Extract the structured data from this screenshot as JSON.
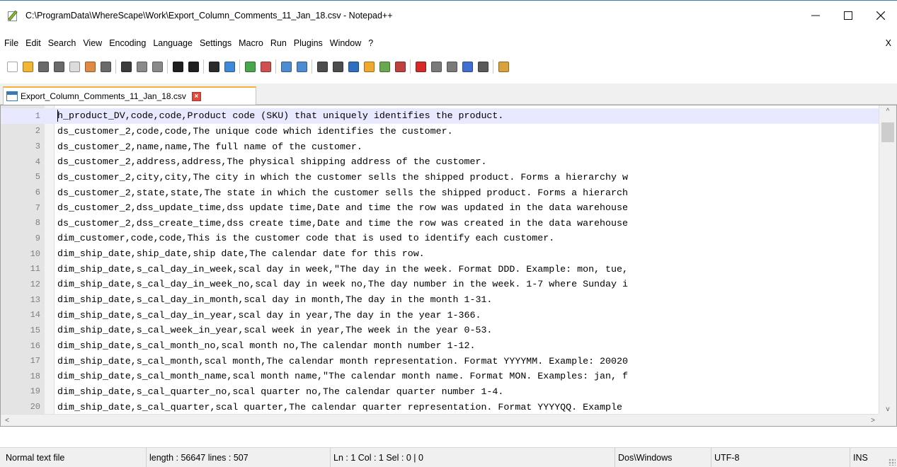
{
  "window": {
    "title": "C:\\ProgramData\\WhereScape\\Work\\Export_Column_Comments_11_Jan_18.csv - Notepad++",
    "minimize_glyph": "—",
    "maximize_glyph": "☐",
    "close_glyph": "✕"
  },
  "menu": {
    "items": [
      "File",
      "Edit",
      "Search",
      "View",
      "Encoding",
      "Language",
      "Settings",
      "Macro",
      "Run",
      "Plugins",
      "Window",
      "?"
    ],
    "close_label": "X"
  },
  "toolbar": {
    "icons": [
      {
        "name": "new-file-icon",
        "color": "#ffffff"
      },
      {
        "name": "open-file-icon",
        "color": "#f2b636"
      },
      {
        "name": "save-icon",
        "color": "#6a6a6a"
      },
      {
        "name": "save-all-icon",
        "color": "#6a6a6a"
      },
      {
        "name": "close-file-icon",
        "color": "#dcdcdc"
      },
      {
        "name": "close-all-icon",
        "color": "#e08b45"
      },
      {
        "name": "print-icon",
        "color": "#6a6a6a"
      },
      {
        "sep": true
      },
      {
        "name": "cut-icon",
        "color": "#3b3b3b"
      },
      {
        "name": "copy-icon",
        "color": "#8a8a8a"
      },
      {
        "name": "paste-icon",
        "color": "#8a8a8a"
      },
      {
        "sep": true
      },
      {
        "name": "undo-icon",
        "color": "#1f1f1f"
      },
      {
        "name": "redo-icon",
        "color": "#1f1f1f"
      },
      {
        "sep": true
      },
      {
        "name": "find-icon",
        "color": "#2b2b2b"
      },
      {
        "name": "replace-icon",
        "color": "#3e8ad8"
      },
      {
        "sep": true
      },
      {
        "name": "zoom-in-icon",
        "color": "#4aa64a"
      },
      {
        "name": "zoom-out-icon",
        "color": "#d05050"
      },
      {
        "sep": true
      },
      {
        "name": "sync-vertical-icon",
        "color": "#4d8cd1"
      },
      {
        "name": "sync-horizontal-icon",
        "color": "#4d8cd1"
      },
      {
        "sep": true
      },
      {
        "name": "word-wrap-icon",
        "color": "#4d4d4d"
      },
      {
        "name": "show-all-chars-icon",
        "color": "#4d4d4d"
      },
      {
        "name": "indent-guide-icon",
        "color": "#2f6fbf"
      },
      {
        "name": "doc-map-icon",
        "color": "#f0a830"
      },
      {
        "name": "function-list-icon",
        "color": "#6aa84f"
      },
      {
        "name": "folder-as-workspace-icon",
        "color": "#c04040"
      },
      {
        "sep": true
      },
      {
        "name": "record-macro-icon",
        "color": "#d42a2a"
      },
      {
        "name": "stop-macro-icon",
        "color": "#7a7a7a"
      },
      {
        "name": "play-macro-icon",
        "color": "#7a7a7a"
      },
      {
        "name": "run-macro-multiple-icon",
        "color": "#3f6fd0"
      },
      {
        "name": "save-macro-icon",
        "color": "#5a5a5a"
      },
      {
        "sep": true
      },
      {
        "name": "plugin-icon",
        "color": "#d9a23a"
      }
    ]
  },
  "tab": {
    "label": "Export_Column_Comments_11_Jan_18.csv",
    "close_glyph": "×"
  },
  "editor": {
    "lines": [
      {
        "n": "1",
        "text": "h_product_DV,code,code,Product code (SKU) that uniquely identifies the product."
      },
      {
        "n": "2",
        "text": "ds_customer_2,code,code,The unique code which identifies the customer."
      },
      {
        "n": "3",
        "text": "ds_customer_2,name,name,The full name of the customer."
      },
      {
        "n": "4",
        "text": "ds_customer_2,address,address,The physical shipping address of the customer."
      },
      {
        "n": "5",
        "text": "ds_customer_2,city,city,The city in which the customer sells the shipped product. Forms a hierarchy w"
      },
      {
        "n": "6",
        "text": "ds_customer_2,state,state,The state in which the customer sells the shipped product. Forms a hierarch"
      },
      {
        "n": "7",
        "text": "ds_customer_2,dss_update_time,dss update time,Date and time the row was updated in the data warehouse"
      },
      {
        "n": "8",
        "text": "ds_customer_2,dss_create_time,dss create time,Date and time the row was created in the data warehouse"
      },
      {
        "n": "9",
        "text": "dim_customer,code,code,This is the customer code that is used to identify each customer."
      },
      {
        "n": "10",
        "text": "dim_ship_date,ship_date,ship date,The calendar date for this row."
      },
      {
        "n": "11",
        "text": "dim_ship_date,s_cal_day_in_week,scal day in week,\"The day in the week. Format DDD. Example: mon, tue,"
      },
      {
        "n": "12",
        "text": "dim_ship_date,s_cal_day_in_week_no,scal day in week no,The day number in the week. 1-7 where Sunday i"
      },
      {
        "n": "13",
        "text": "dim_ship_date,s_cal_day_in_month,scal day in month,The day in the month 1-31."
      },
      {
        "n": "14",
        "text": "dim_ship_date,s_cal_day_in_year,scal day in year,The day in the year 1-366."
      },
      {
        "n": "15",
        "text": "dim_ship_date,s_cal_week_in_year,scal week in year,The week in the year 0-53."
      },
      {
        "n": "16",
        "text": "dim_ship_date,s_cal_month_no,scal month no,The calendar month number 1-12."
      },
      {
        "n": "17",
        "text": "dim_ship_date,s_cal_month,scal month,The calendar month representation. Format YYYYMM. Example: 20020"
      },
      {
        "n": "18",
        "text": "dim_ship_date,s_cal_month_name,scal month name,\"The calendar month name. Format MON. Examples: jan, f"
      },
      {
        "n": "19",
        "text": "dim_ship_date,s_cal_quarter_no,scal quarter no,The calendar quarter number 1-4."
      },
      {
        "n": "20",
        "text": "dim_ship_date,s_cal_quarter,scal quarter,The calendar quarter representation. Format YYYYQQ. Example"
      }
    ],
    "current_line": 1,
    "vscroll_up": "^",
    "vscroll_down": "v",
    "hscroll_left": "<",
    "hscroll_right": ">"
  },
  "status": {
    "file_type": "Normal text file",
    "length": "length : 56647    lines : 507",
    "position": "Ln : 1    Col : 1    Sel : 0 | 0",
    "eol": "Dos\\Windows",
    "encoding": "UTF-8",
    "mode": "INS"
  }
}
